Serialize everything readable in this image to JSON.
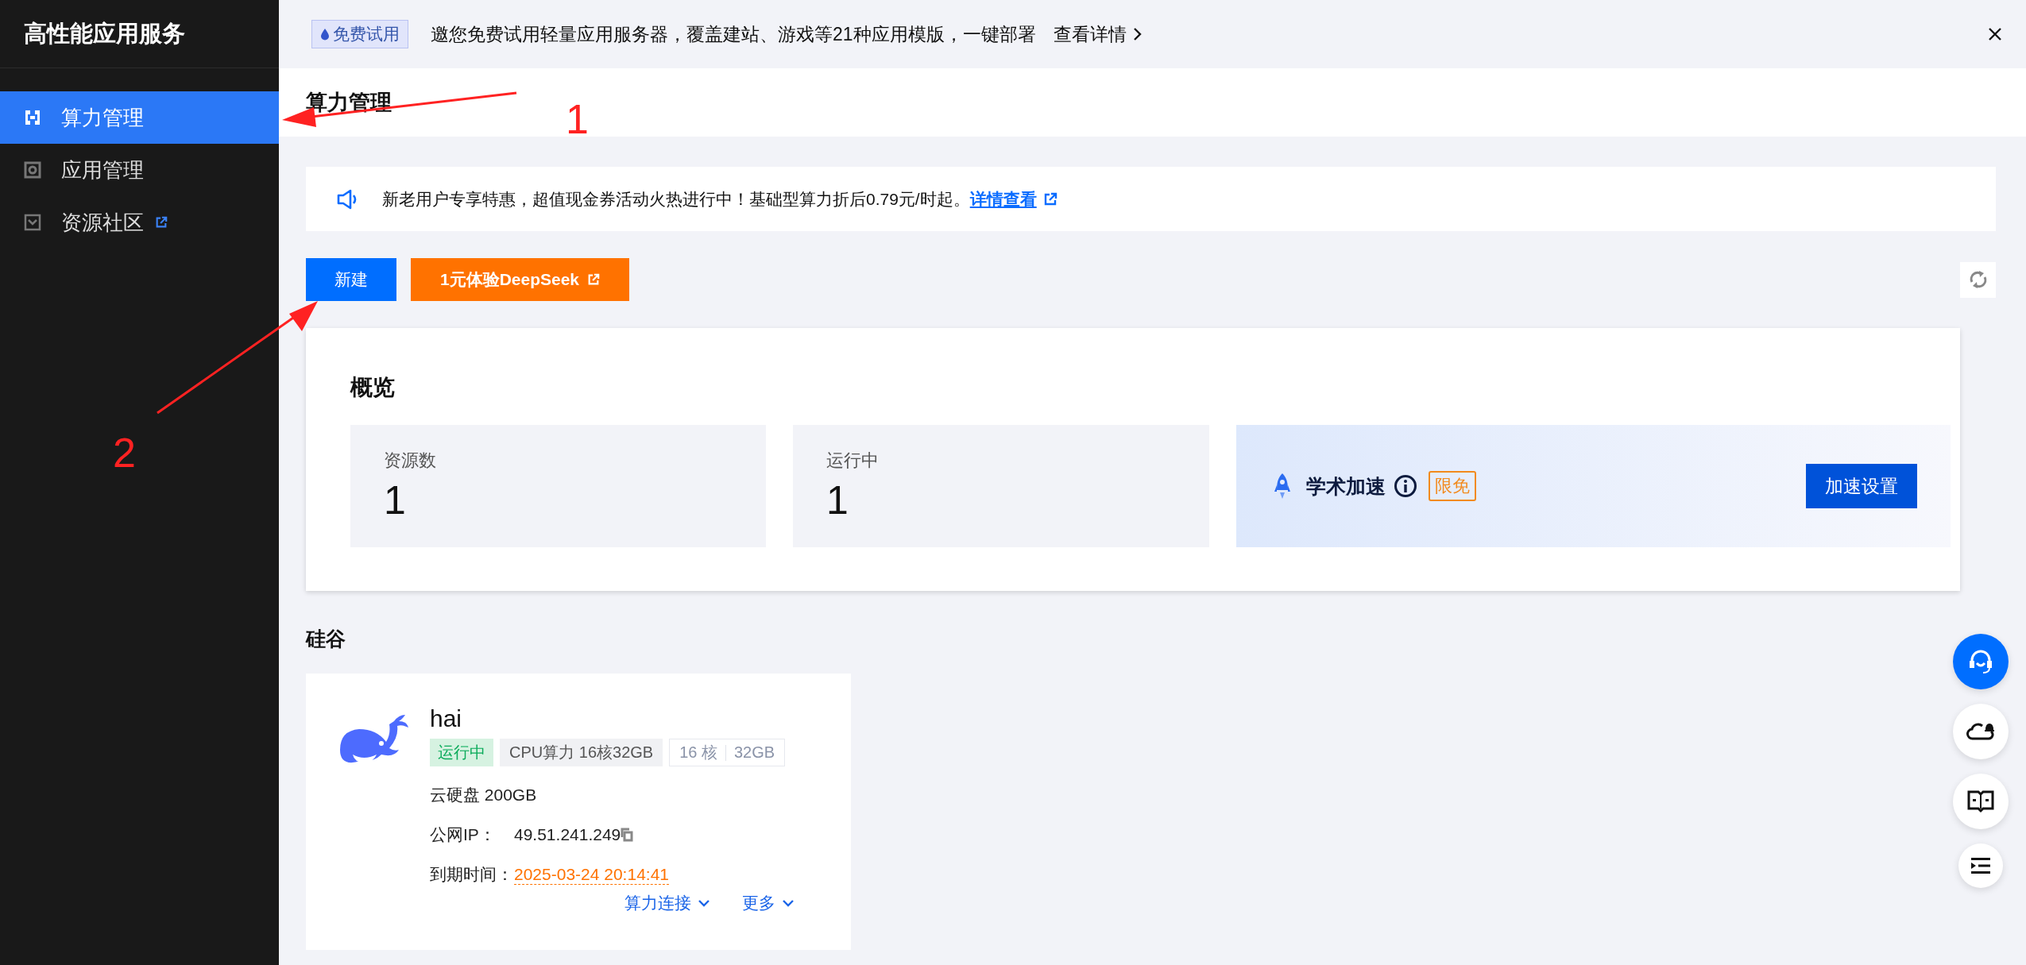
{
  "sidebar": {
    "title": "高性能应用服务",
    "items": [
      {
        "label": "算力管理",
        "selected": true,
        "external": false
      },
      {
        "label": "应用管理",
        "selected": false,
        "external": false
      },
      {
        "label": "资源社区",
        "selected": false,
        "external": true
      }
    ]
  },
  "promo_banner": {
    "badge": "免费试用",
    "text": "邀您免费试用轻量应用服务器，覆盖建站、游戏等21种应用模版，一键部署",
    "link": "查看详情"
  },
  "page_title": "算力管理",
  "notice": {
    "text": "新老用户专享特惠，超值现金券活动火热进行中！基础型算力折后0.79元/时起。",
    "link": "详情查看"
  },
  "toolbar": {
    "buttons": [
      {
        "label": "新建",
        "kind": "primary",
        "external": false
      },
      {
        "label": "1元体验DeepSeek",
        "kind": "promo",
        "external": true
      }
    ]
  },
  "overview": {
    "title": "概览",
    "stats": [
      {
        "label": "资源数",
        "value": "1"
      },
      {
        "label": "运行中",
        "value": "1"
      }
    ],
    "acceleration": {
      "title": "学术加速",
      "badge": "限免",
      "button": "加速设置"
    }
  },
  "region": "硅谷",
  "instances": [
    {
      "name": "hai",
      "status": "运行中",
      "tag": "CPU算力 16核32GB",
      "specs": [
        "16 核",
        "32GB"
      ],
      "disk": "云硬盘 200GB",
      "ip_label": "公网IP：",
      "ip": "49.51.241.249",
      "expiry_label": "到期时间：",
      "expiry": "2025-03-24 20:14:41",
      "actions": [
        "算力连接",
        "更多"
      ]
    }
  ],
  "annotations": [
    {
      "label": "1"
    },
    {
      "label": "2"
    }
  ]
}
